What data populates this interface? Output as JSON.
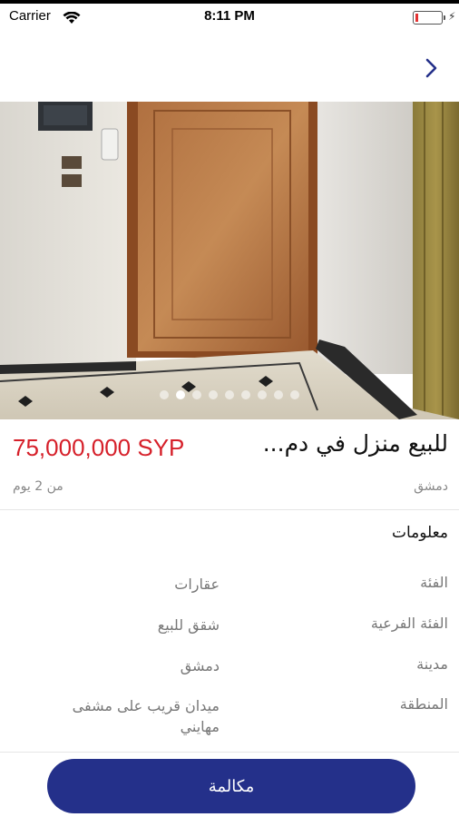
{
  "status_bar": {
    "carrier": "Carrier",
    "time": "8:11 PM",
    "battery_level": 0.12,
    "battery_color": "#e33333"
  },
  "nav": {
    "back_icon": "chevron-right-icon"
  },
  "gallery": {
    "photo_subject": "door-photo",
    "page_count": 9,
    "active_index": 1
  },
  "listing": {
    "price": "75,000,000 SYP",
    "title": "للبيع منزل في دم...",
    "city": "دمشق",
    "posted": "من 2 يوم"
  },
  "info": {
    "section_title": "معلومات",
    "rows": [
      {
        "label": "الفئة",
        "value": "عقارات"
      },
      {
        "label": "الفئة الفرعية",
        "value": "شقق للبيع"
      },
      {
        "label": "مدينة",
        "value": "دمشق"
      },
      {
        "label": "المنطقة",
        "value": "ميدان قريب على مشفى مهايني"
      }
    ]
  },
  "actions": {
    "call_label": "مكالمة"
  },
  "colors": {
    "price": "#d6202a",
    "accent": "#24308a"
  }
}
